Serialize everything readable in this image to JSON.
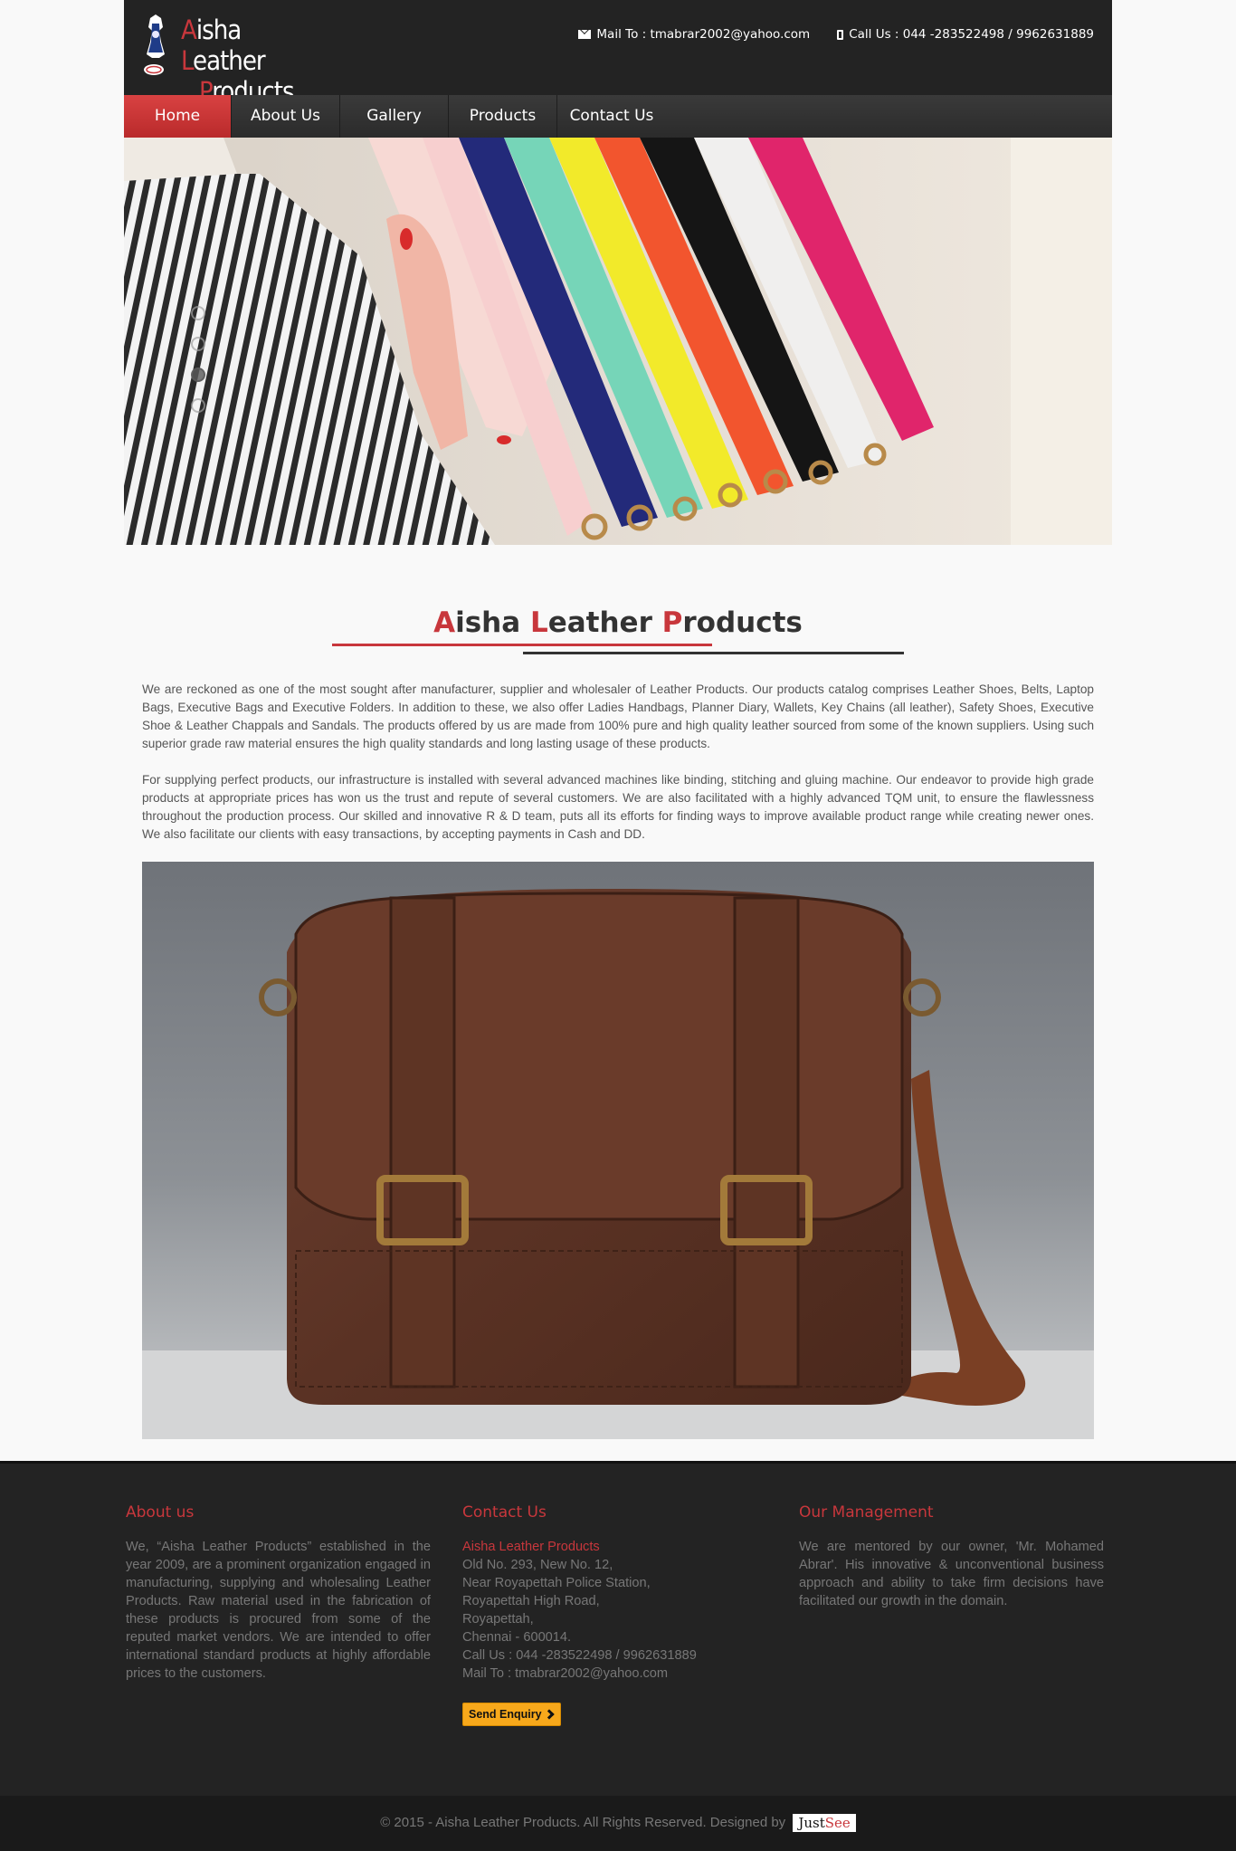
{
  "brand": {
    "logo_initial_1": "A",
    "logo_rest_1": "isha ",
    "logo_initial_2": "L",
    "logo_rest_2": "eather",
    "logo_initial_3": "P",
    "logo_rest_3": "roducts",
    "accent_color": "#c8373c"
  },
  "header": {
    "mail_text": "Mail To : tmabrar2002@yahoo.com",
    "call_text": "Call Us : 044 -283522498 / 9962631889"
  },
  "nav": {
    "items": [
      {
        "label": "Home",
        "active": true
      },
      {
        "label": "About Us"
      },
      {
        "label": "Gallery"
      },
      {
        "label": "Products"
      },
      {
        "label": "Contact Us"
      }
    ]
  },
  "slider": {
    "dot_count": 4,
    "active_dot": 3
  },
  "main": {
    "title_a": "A",
    "title_a_rest": "isha ",
    "title_l": "L",
    "title_l_rest": "eather ",
    "title_p": "P",
    "title_p_rest": "roducts",
    "paragraph_1": "We are reckoned as one of the most sought after manufacturer, supplier and wholesaler of Leather Products. Our products catalog comprises Leather Shoes, Belts, Laptop Bags, Executive Bags and Executive Folders. In addition to these, we also offer Ladies Handbags, Planner Diary, Wallets, Key Chains (all leather), Safety Shoes, Executive Shoe & Leather Chappals and Sandals. The products offered by us are made from 100% pure and high quality leather sourced from some of the known suppliers. Using such superior grade raw material ensures the high quality standards and long lasting usage of these products.",
    "paragraph_2": "For supplying perfect products, our infrastructure is installed with several advanced machines like binding, stitching and gluing machine. Our endeavor to provide high grade products at appropriate prices has won us the trust and repute of several customers. We are also facilitated with a highly advanced TQM unit, to ensure the flawlessness throughout the production process. Our skilled and innovative R & D team, puts all its efforts for finding ways to improve available product range while creating newer ones. We also facilitate our clients with easy transactions, by accepting payments in Cash and DD."
  },
  "footer": {
    "about": {
      "heading": "About us",
      "text": "We, “Aisha Leather Products” established in the year 2009, are a prominent organization engaged in manufacturing, supplying and wholesaling Leather Products. Raw material used in the fabrication of these products is procured from some of the reputed market vendors. We are intended to offer international standard products at highly affordable prices to the customers."
    },
    "contact": {
      "heading": "Contact Us",
      "company": "Aisha Leather Products",
      "lines": [
        "Old No. 293, New No. 12,",
        "Near Royapettah Police Station,",
        "Royapettah High Road,",
        "Royapettah,",
        "Chennai - 600014.",
        "Call Us : 044 -283522498 / 9962631889",
        "Mail To : tmabrar2002@yahoo.com"
      ],
      "enquiry_label": "Send Enquiry"
    },
    "management": {
      "heading": "Our Management",
      "text": "We are mentored by our owner, 'Mr. Mohamed Abrar'. His innovative & unconventional business approach and ability to take firm decisions have facilitated our growth in the domain."
    },
    "copyright": "© 2015 - Aisha Leather Products. All Rights Reserved. Designed by",
    "designer_part1": "Just",
    "designer_part2": "See"
  }
}
